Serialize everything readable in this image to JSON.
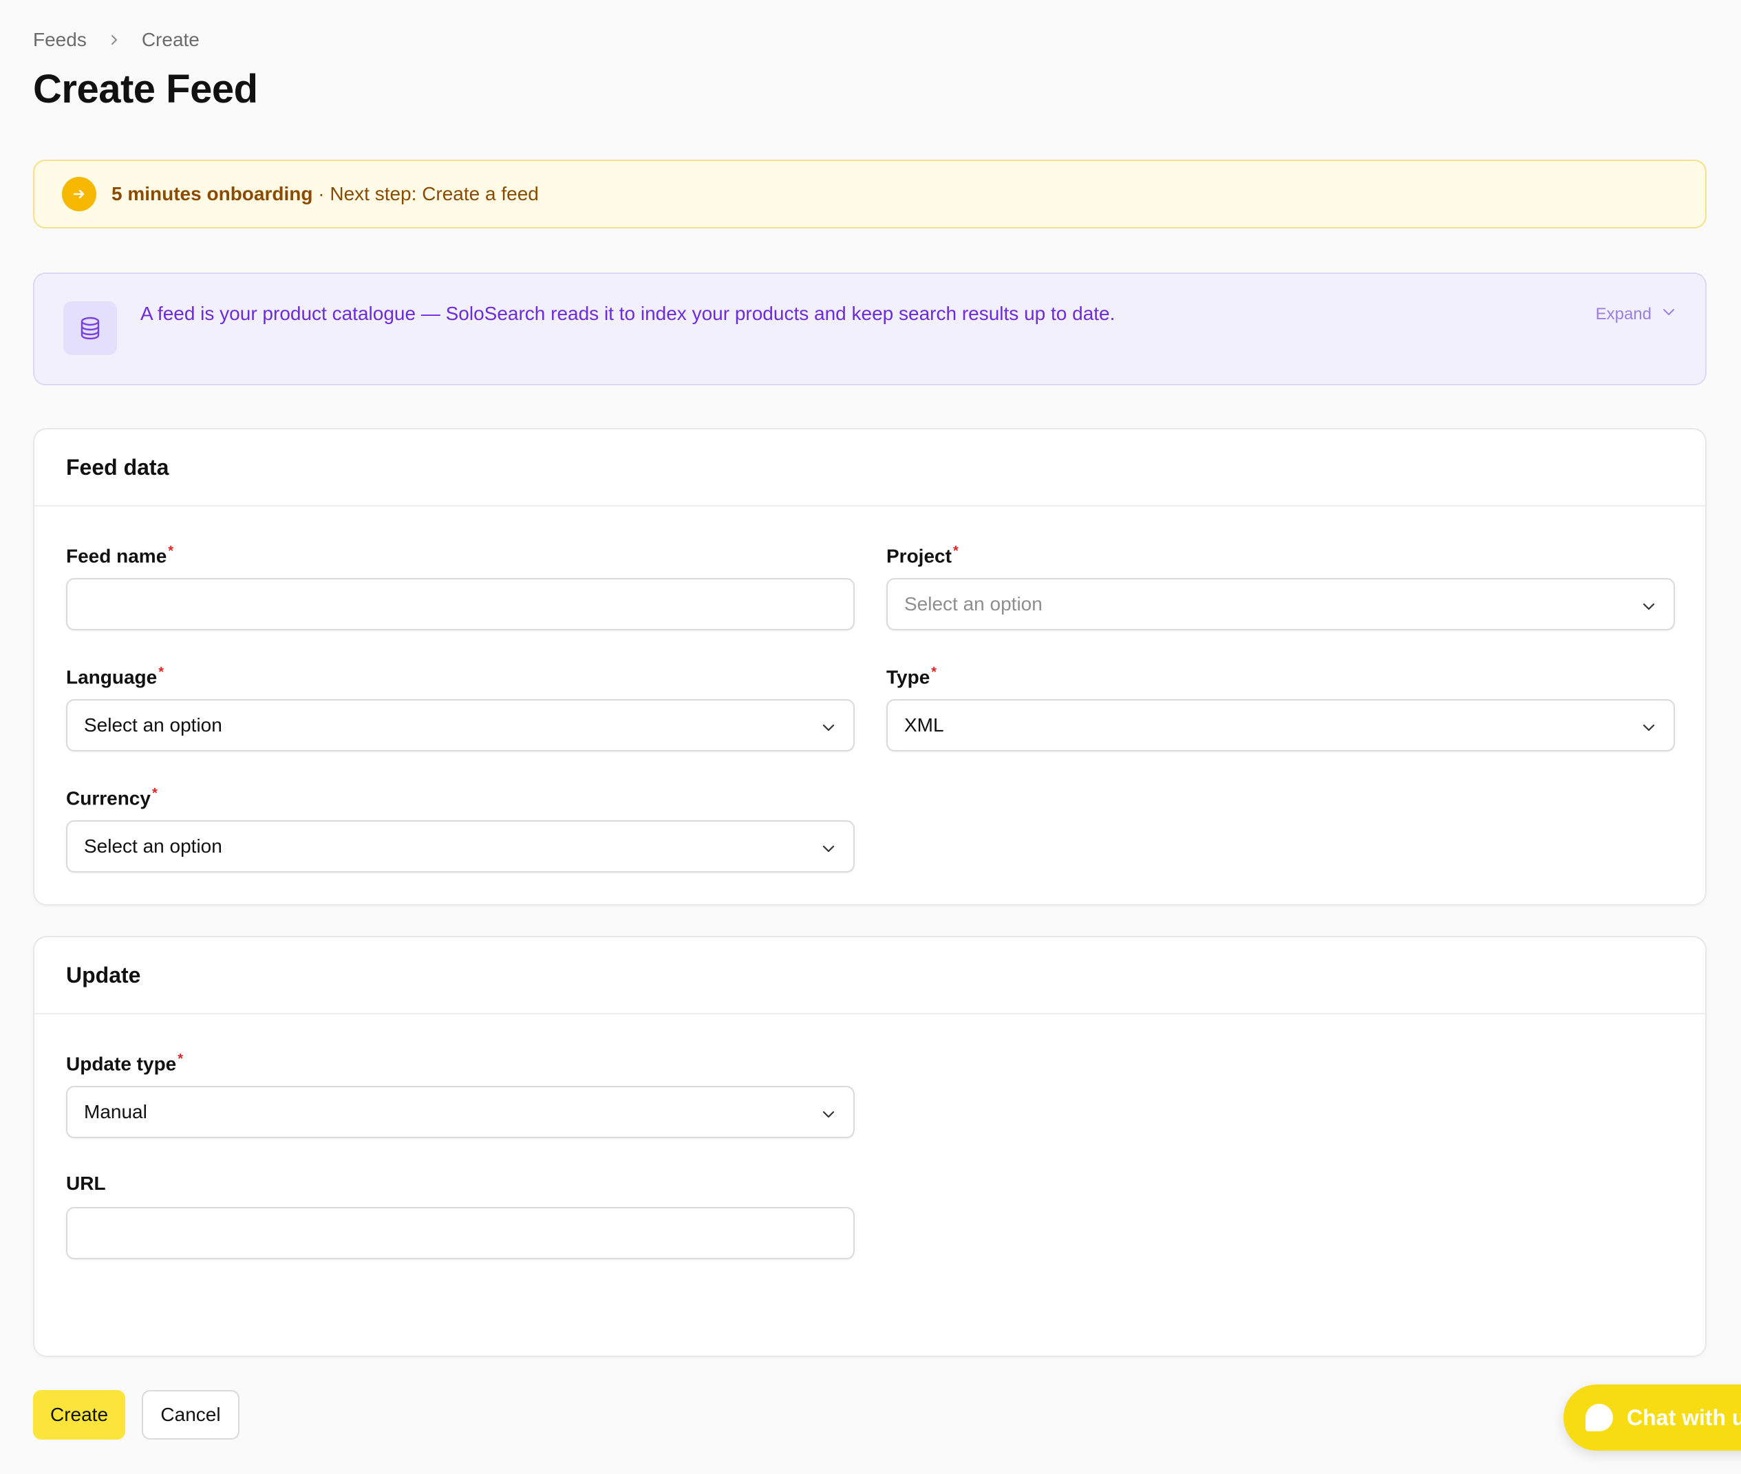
{
  "breadcrumb": {
    "items": [
      "Feeds",
      "Create"
    ]
  },
  "page": {
    "title": "Create Feed"
  },
  "onboarding": {
    "strong": "5 minutes onboarding",
    "text": "· Next step: Create a feed"
  },
  "info": {
    "text": "A feed is your product catalogue — SoloSearch reads it to index your products and keep search results up to date.",
    "expand_label": "Expand"
  },
  "feed_data": {
    "title": "Feed data",
    "feed_name": {
      "label": "Feed name",
      "value": ""
    },
    "project": {
      "label": "Project",
      "value": "Select an option"
    },
    "language": {
      "label": "Language",
      "value": "Select an option"
    },
    "type": {
      "label": "Type",
      "value": "XML"
    },
    "currency": {
      "label": "Currency",
      "value": "Select an option"
    }
  },
  "update": {
    "title": "Update",
    "update_type": {
      "label": "Update type",
      "value": "Manual"
    },
    "url": {
      "label": "URL",
      "value": ""
    }
  },
  "actions": {
    "create_label": "Create",
    "cancel_label": "Cancel"
  },
  "chat": {
    "label": "Chat with us"
  },
  "colors": {
    "accent": "#fce53a",
    "info_text": "#6d2bd9",
    "onboarding_text": "#8a4b00",
    "required": "#e02424"
  }
}
